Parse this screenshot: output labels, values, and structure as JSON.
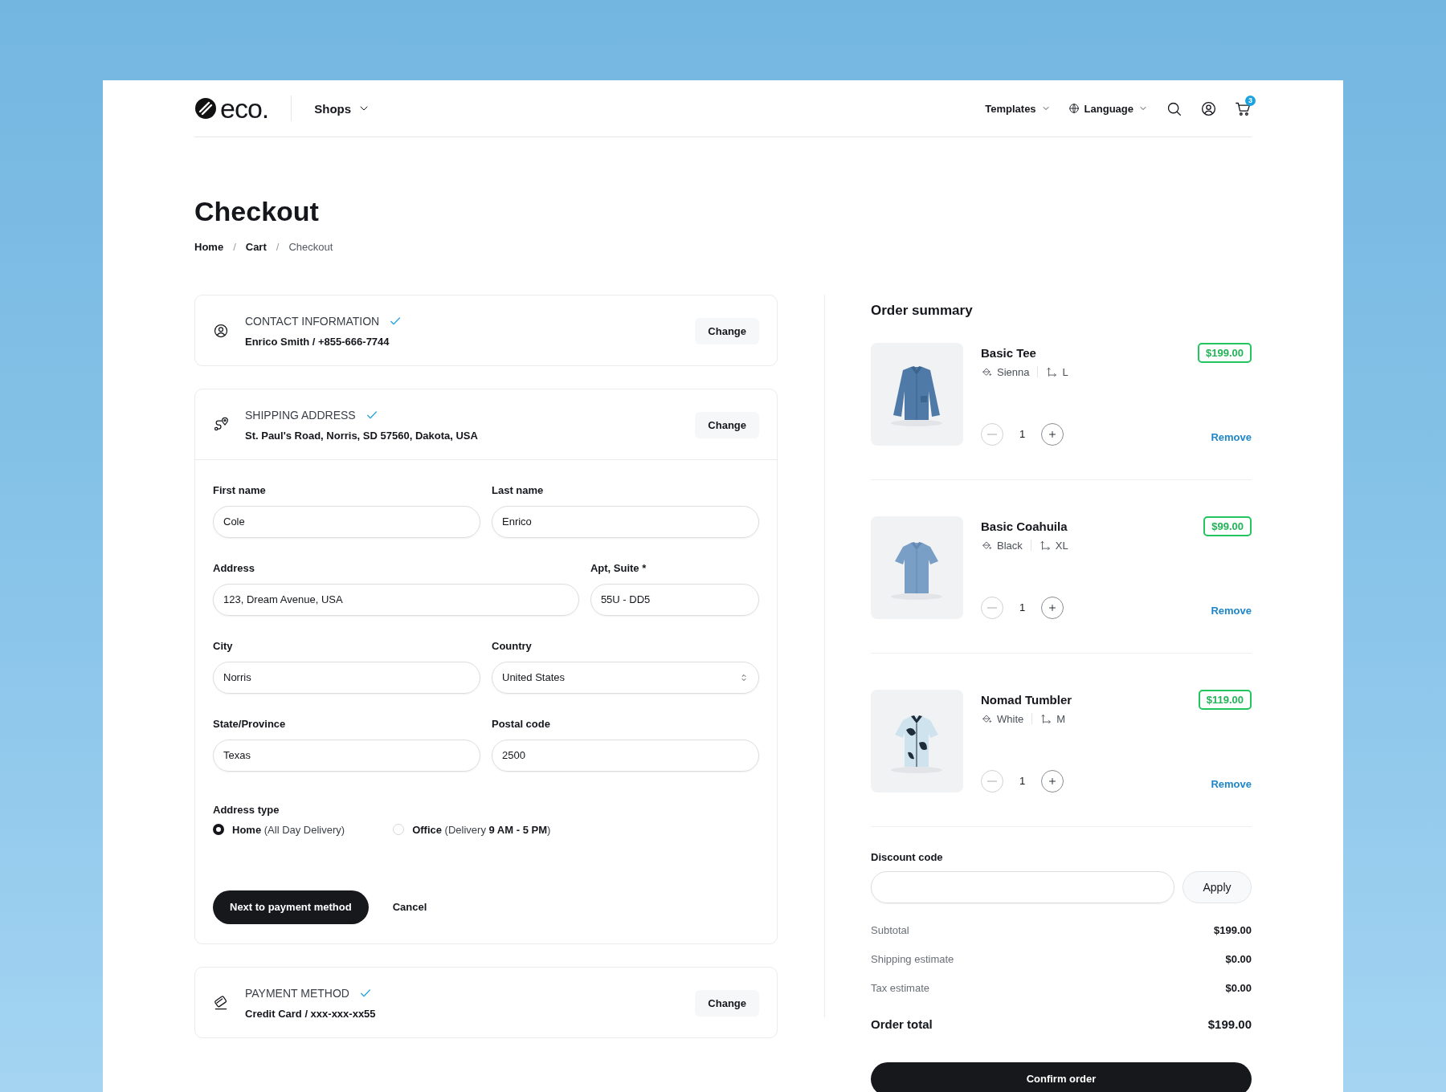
{
  "header": {
    "logo": "eco.",
    "nav": [
      {
        "label": "Shops"
      }
    ],
    "right_nav": [
      {
        "label": "Templates",
        "kind": "menu"
      },
      {
        "label": "Language",
        "kind": "language"
      }
    ],
    "cart_count": "3"
  },
  "page_title": "Checkout",
  "breadcrumb": [
    {
      "label": "Home",
      "current": false
    },
    {
      "separator": "/",
      "label": "Cart",
      "current": false
    },
    {
      "separator": "/",
      "label": "Checkout",
      "current": true
    }
  ],
  "steps": [
    {
      "kind": "contact",
      "title": "CONTACT INFORMATION",
      "completed": true,
      "summary": "Enrico Smith / +855-666-7744",
      "action": "Change",
      "expanded": false
    },
    {
      "kind": "shipping",
      "title": "SHIPPING ADDRESS",
      "completed": true,
      "summary": "St. Paul's Road, Norris, SD 57560, Dakota, USA",
      "action": "Change",
      "expanded": true
    },
    {
      "kind": "payment",
      "title": "PAYMENT METHOD",
      "completed": true,
      "summary": "Credit Card / xxx-xxx-xx55",
      "action": "Change",
      "expanded": false
    }
  ],
  "shipping_form": {
    "rows": [
      [
        {
          "label": "First name",
          "value": "Cole",
          "kind": "text"
        },
        {
          "label": "Last name",
          "value": "Enrico",
          "kind": "text"
        }
      ],
      [
        {
          "label": "Address",
          "value": "123, Dream Avenue, USA",
          "kind": "text"
        },
        {
          "label": "Apt, Suite *",
          "value": "55U - DD5",
          "kind": "text"
        }
      ],
      [
        {
          "label": "City",
          "value": "Norris",
          "kind": "text"
        },
        {
          "label": "Country",
          "value": "United States",
          "kind": "select"
        }
      ],
      [
        {
          "label": "State/Province",
          "value": "Texas",
          "kind": "text"
        },
        {
          "label": "Postal code",
          "value": "2500",
          "kind": "text"
        }
      ]
    ],
    "address_type": {
      "label": "Address type",
      "options": [
        {
          "label": "**Home** (All Day Delivery)",
          "selected": true
        },
        {
          "label": "**Office** (Delivery **9 AM - 5 PM**)",
          "selected": false
        }
      ]
    },
    "submit": "Next to payment method",
    "cancel": "Cancel"
  },
  "order_summary": {
    "title": "Order summary",
    "items": [
      {
        "name": "Basic Tee",
        "color_name": "Sienna",
        "size": "L",
        "quantity": "1",
        "price": "$199.00",
        "remove": "Remove"
      },
      {
        "name": "Basic Coahuila",
        "color_name": "Black",
        "size": "XL",
        "quantity": "1",
        "price": "$99.00",
        "remove": "Remove"
      },
      {
        "name": "Nomad Tumbler",
        "color_name": "White",
        "size": "M",
        "quantity": "1",
        "price": "$119.00",
        "remove": "Remove"
      }
    ],
    "discount": {
      "label": "Discount code",
      "button": "Apply"
    },
    "totals": [
      {
        "label": "Subtotal",
        "value": "$199.00",
        "kind": "line"
      },
      {
        "label": "Shipping estimate",
        "value": "$0.00",
        "kind": "line"
      },
      {
        "label": "Tax estimate",
        "value": "$0.00",
        "kind": "line"
      },
      {
        "label": "Order total",
        "value": "$199.00",
        "kind": "total"
      }
    ],
    "confirm": "Confirm order"
  }
}
